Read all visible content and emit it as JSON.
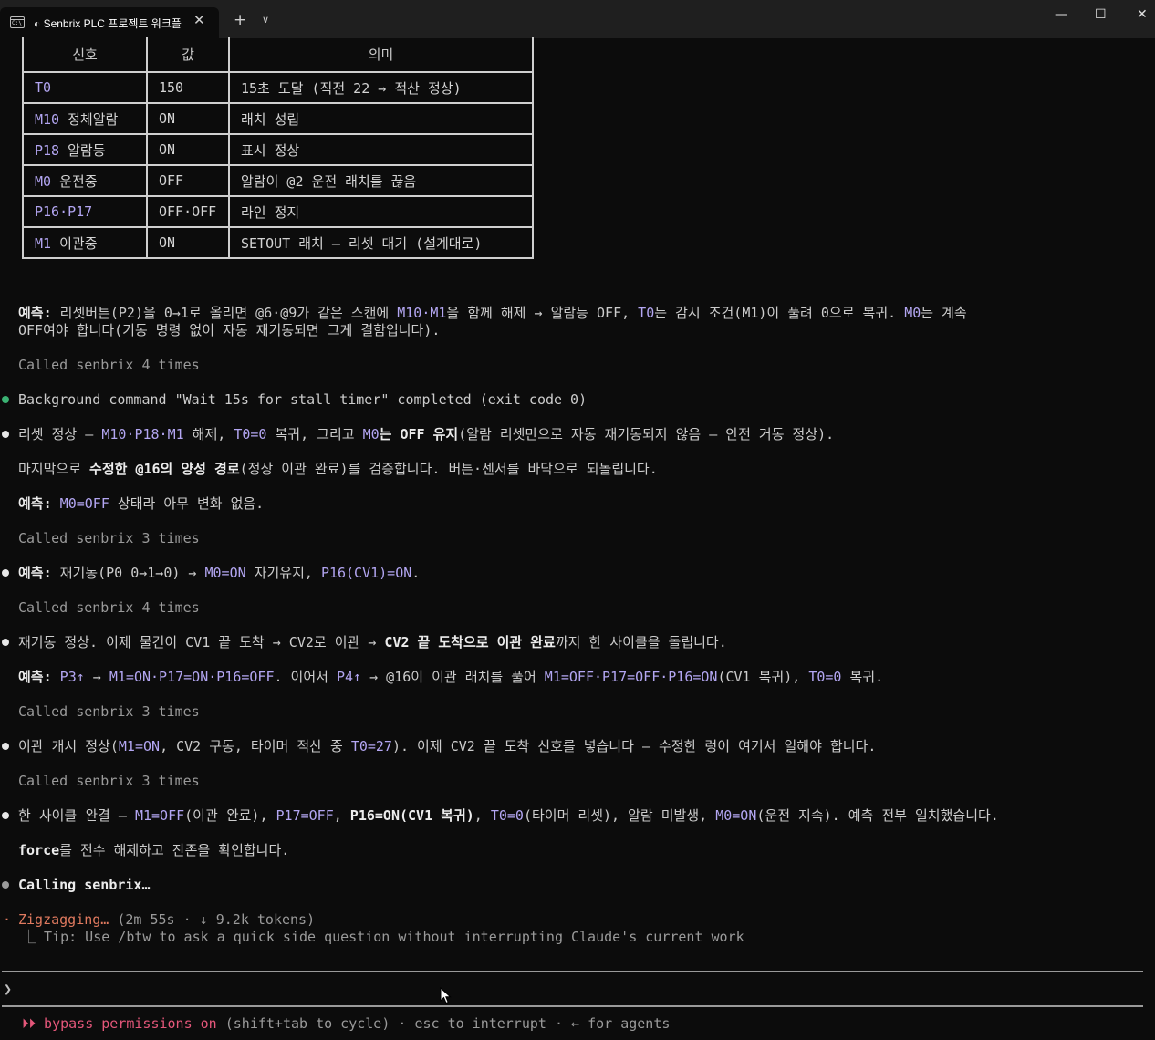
{
  "window": {
    "tab_title": "◐ Senbrix PLC 프로젝트 워크플",
    "tab_close": "✕",
    "new_tab": "+",
    "tab_menu": "∨",
    "minimize": "—",
    "maximize": "☐",
    "close": "✕"
  },
  "table": {
    "headers": [
      "신호",
      "값",
      "의미"
    ],
    "rows": [
      {
        "sig": "T0",
        "sig_rest": "",
        "val": "150",
        "meaning": "15초 도달 (직전 22 → 적산 정상)"
      },
      {
        "sig": "M10",
        "sig_rest": " 정체알람",
        "val": "ON",
        "meaning": "래치 성립"
      },
      {
        "sig": "P18",
        "sig_rest": " 알람등",
        "val": "ON",
        "meaning": "표시 정상"
      },
      {
        "sig": "M0",
        "sig_rest": " 운전중",
        "val": "OFF",
        "meaning": "알람이 @2 운전 래치를 끊음"
      },
      {
        "sig": "P16·P17",
        "sig_rest": "",
        "val": "OFF·OFF",
        "meaning": "라인 정지"
      },
      {
        "sig": "M1",
        "sig_rest": " 이관중",
        "val": "ON",
        "meaning": "SETOUT 래치 — 리셋 대기 (설계대로)"
      }
    ]
  },
  "transcript": {
    "pred1": {
      "label": "예측:",
      "a": " 리셋버튼(P2)을 0→1로 올리면 @6·@9가 같은 스캔에 ",
      "m10m1": "M10·M1",
      "b": "을 함께 해제 → 알람등 OFF, ",
      "t0": "T0",
      "c": "는 감시 조건(M1)이 풀려 0으로 복귀. ",
      "m0": "M0",
      "d": "는 계속",
      "line2": "OFF여야 합니다(기동 명령 없이 자동 재기동되면 그게 결함입니다)."
    },
    "called1": "Called senbrix 4 times",
    "bg_cmd": "Background command \"Wait 15s for stall timer\" completed (exit code 0)",
    "reset": {
      "a": "리셋 정상 — ",
      "sig1": "M10·P18·M1",
      "b": " 해제, ",
      "sig2": "T0=0",
      "c": " 복귀, 그리고 ",
      "sig3": "M0",
      "d": "는 OFF 유지",
      "e": "(알람 리셋만으로 자동 재기동되지 않음 — 안전 거동 정상)."
    },
    "final": {
      "a": "마지막으로 ",
      "bold": "수정한 @16의 양성 경로",
      "b": "(정상 이관 완료)를 검증합니다. 버튼·센서를 바닥으로 되돌립니다."
    },
    "pred2": {
      "label": "예측:",
      "sig": "M0=OFF",
      "rest": " 상태라 아무 변화 없음."
    },
    "called2": "Called senbrix 3 times",
    "pred3": {
      "label": "예측:",
      "a": " 재기동(P0 0→1→0) → ",
      "sig1": "M0=ON",
      "b": " 자기유지, ",
      "sig2": "P16(CV1)=ON",
      "c": "."
    },
    "called3": "Called senbrix 4 times",
    "restart": {
      "a": "재기동 정상. 이제 물건이 CV1 끝 도착 → CV2로 이관 → ",
      "bold": "CV2 끝 도착으로 이관 완료",
      "b": "까지 한 사이클을 돌립니다."
    },
    "pred4": {
      "label": "예측:",
      "s1": "P3↑",
      "a": " → ",
      "s2": "M1=ON·P17=ON·P16=OFF",
      "b": ". 이어서 ",
      "s3": "P4↑",
      "c": " → @16이 이관 래치를 풀어 ",
      "s4": "M1=OFF·P17=OFF·P16=ON",
      "d": "(CV1 복귀), ",
      "s5": "T0=0",
      "e": " 복귀."
    },
    "called4": "Called senbrix 3 times",
    "transfer": {
      "a": "이관 개시 정상(",
      "s1": "M1=ON",
      "b": ", CV2 구동, 타이머 적산 중 ",
      "s2": "T0=27",
      "c": "). 이제 CV2 끝 도착 신호를 넣습니다 — 수정한 렁이 여기서 일해야 합니다."
    },
    "called5": "Called senbrix 3 times",
    "cycle": {
      "a": "한 사이클 완결 — ",
      "s1": "M1=OFF",
      "b": "(이관 완료), ",
      "s2": "P17=OFF",
      "c": ", ",
      "s3": "P16=ON",
      "d": "(CV1 복귀)",
      "e": ", ",
      "s4": "T0=0",
      "f": "(타이머 리셋), 알람 미발생, ",
      "s5": "M0=ON",
      "g": "(운전 지속). 예측 전부 일치했습니다."
    },
    "force": {
      "word": "force",
      "rest": "를 전수 해제하고 잔존을 확인합니다."
    },
    "calling": "Calling senbrix…"
  },
  "spinner": {
    "glyph": "·",
    "verb": "Zigzagging…",
    "meta": " (2m 55s · ↓ 9.2k tokens)",
    "tip": "⎿  Tip: Use /btw to ask a quick side question without interrupting Claude's current work"
  },
  "input": {
    "prompt": "❯",
    "value": ""
  },
  "status": {
    "mode_icon": "⏵⏵",
    "mode": " bypass permissions on",
    "rest": " (shift+tab to cycle) · esc to interrupt · ← for agents"
  },
  "colors": {
    "accent_purple": "#b3a6f2",
    "spinner_orange": "#e07a5f",
    "mode_red": "#e4577a",
    "ok_green": "#3bb273"
  }
}
